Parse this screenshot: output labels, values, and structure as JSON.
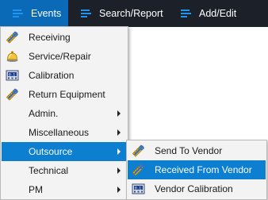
{
  "menubar": {
    "items": [
      {
        "label": "Events",
        "icon": "menu-lines-icon",
        "active": true
      },
      {
        "label": "Search/Report",
        "icon": "menu-lines-icon",
        "active": false
      },
      {
        "label": "Add/Edit",
        "icon": "menu-lines-icon",
        "active": false
      }
    ]
  },
  "events_menu": {
    "items": [
      {
        "label": "Receiving",
        "icon": "wrench-ruler-icon"
      },
      {
        "label": "Service/Repair",
        "icon": "service-bell-icon"
      },
      {
        "label": "Calibration",
        "icon": "calibration-meter-icon"
      },
      {
        "label": "Return Equipment",
        "icon": "wrench-ruler-icon"
      },
      {
        "label": "Admin.",
        "submenu": true
      },
      {
        "label": "Miscellaneous",
        "submenu": true
      },
      {
        "label": "Outsource",
        "submenu": true,
        "highlighted": true
      },
      {
        "label": "Technical",
        "submenu": true
      },
      {
        "label": "PM",
        "submenu": true
      }
    ]
  },
  "outsource_menu": {
    "items": [
      {
        "label": "Send To Vendor",
        "icon": "wrench-ruler-icon"
      },
      {
        "label": "Received From Vendor",
        "icon": "wrench-ruler-icon",
        "highlighted": true
      },
      {
        "label": "Vendor Calibration",
        "icon": "calibration-meter-icon"
      }
    ]
  },
  "colors": {
    "menubar_bg": "#1c2129",
    "menubar_active": "#0a6ab8",
    "highlight": "#0c7fd1",
    "menu_bg": "#f3f3f3",
    "icon_accent": "#1e95f0"
  }
}
